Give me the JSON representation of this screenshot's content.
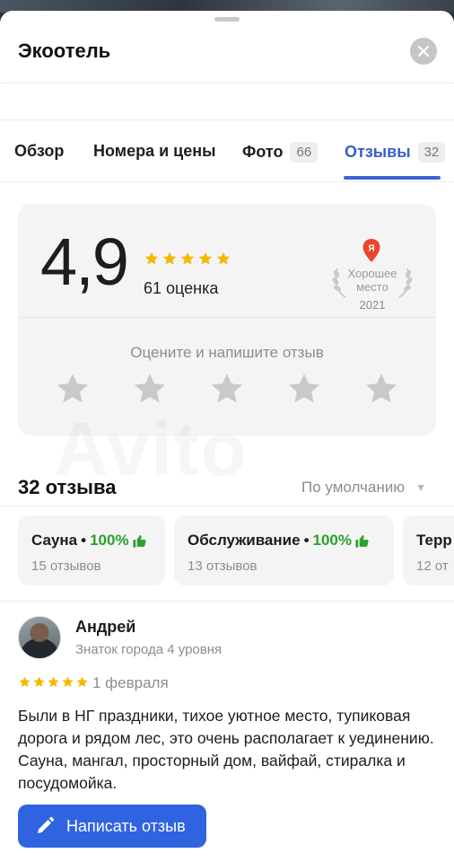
{
  "header": {
    "title": "Экоотель"
  },
  "tabs": [
    {
      "label": "Обзор"
    },
    {
      "label": "Номера и цены"
    },
    {
      "label": "Фото",
      "count": "66"
    },
    {
      "label": "Отзывы",
      "count": "32",
      "active": true
    }
  ],
  "rating": {
    "score": "4,9",
    "stars": 5,
    "count_label": "61 оценка",
    "award_line1": "Хорошее",
    "award_line2": "место",
    "award_year": "2021",
    "award_badge": "Я",
    "rate_prompt": "Оцените и напишите отзыв"
  },
  "watermark": "Avito",
  "reviews": {
    "heading": "32 отзыва",
    "sort_label": "По умолчанию"
  },
  "chips": [
    {
      "name": "Сауна",
      "percent": "100%",
      "sub": "15 отзывов"
    },
    {
      "name": "Обслуживание",
      "percent": "100%",
      "sub": "13 отзывов"
    },
    {
      "name": "Терр",
      "percent": "",
      "sub": "12 от"
    }
  ],
  "review": {
    "author": "Андрей",
    "level": "Знаток города 4 уровня",
    "stars": 5,
    "date": "1 февраля",
    "text": "Были в НГ праздники, тихое уютное место, тупиковая дорога и  рядом лес, это очень располагает к уединению. Сауна, мангал, просторный дом, вайфай, стиралка и посудомойка."
  },
  "actions": {
    "write_review": "Написать отзыв"
  },
  "colors": {
    "accent": "#3d63d1",
    "button": "#2f63e0",
    "star": "#f5b800",
    "positive": "#2ca02c"
  }
}
